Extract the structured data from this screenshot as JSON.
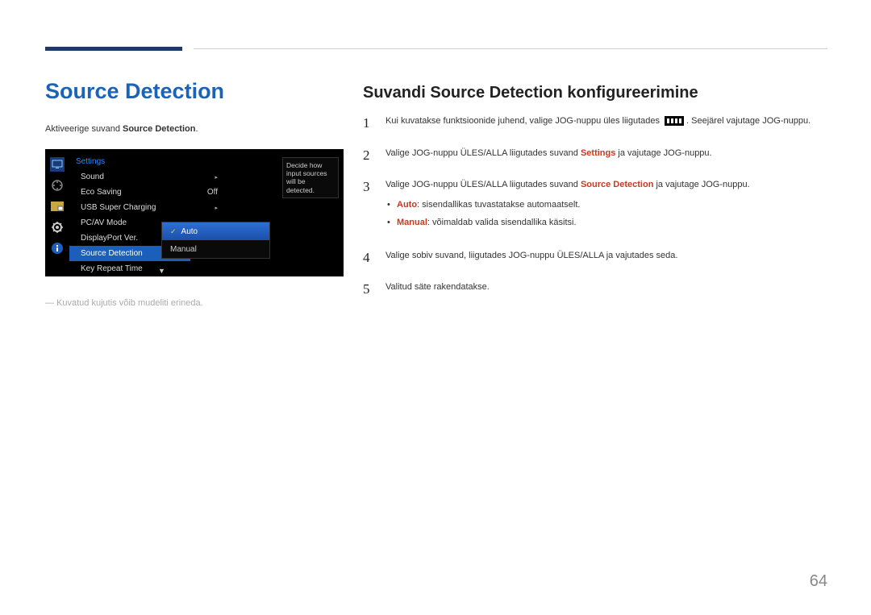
{
  "section_title": "Source Detection",
  "intro_prefix": "Aktiveerige suvand ",
  "intro_strong": "Source Detection",
  "intro_suffix": ".",
  "osd": {
    "menu_title": "Settings",
    "items": [
      {
        "label": "Sound",
        "value": "",
        "arrow": true
      },
      {
        "label": "Eco Saving",
        "value": "Off",
        "arrow": false
      },
      {
        "label": "USB Super Charging",
        "value": "",
        "arrow": true
      },
      {
        "label": "PC/AV Mode",
        "value": "",
        "arrow": true
      },
      {
        "label": "DisplayPort Ver.",
        "value": "",
        "arrow": true
      },
      {
        "label": "Source Detection",
        "value": "",
        "arrow": false,
        "selected": true
      },
      {
        "label": "Key Repeat Time",
        "value": "",
        "arrow": false
      }
    ],
    "submenu": {
      "options": [
        {
          "label": "Auto",
          "selected": true
        },
        {
          "label": "Manual",
          "selected": false
        }
      ]
    },
    "tooltip": "Decide how input sources will be detected."
  },
  "note": "― Kuvatud kujutis võib mudeliti erineda.",
  "right_title": "Suvandi Source Detection konfigureerimine",
  "steps": [
    {
      "num": "1",
      "pre": "Kui kuvatakse funktsioonide juhend, valige JOG-nuppu üles liigutades ",
      "icon": true,
      "post": ". Seejärel vajutage JOG-nuppu."
    },
    {
      "num": "2",
      "pre": "Valige JOG-nuppu ÜLES/ALLA liigutades suvand ",
      "hl": "Settings",
      "post": " ja vajutage JOG-nuppu."
    },
    {
      "num": "3",
      "pre": "Valige JOG-nuppu ÜLES/ALLA liigutades suvand ",
      "hl": "Source Detection",
      "post": " ja vajutage JOG-nuppu.",
      "bullets": [
        {
          "hl": "Auto",
          "text": ": sisendallikas tuvastatakse automaatselt."
        },
        {
          "hl": "Manual",
          "text": ": võimaldab valida sisendallika käsitsi."
        }
      ]
    },
    {
      "num": "4",
      "pre": "Valige sobiv suvand, liigutades JOG-nuppu ÜLES/ALLA ja vajutades seda."
    },
    {
      "num": "5",
      "pre": "Valitud säte rakendatakse."
    }
  ],
  "page_number": "64"
}
